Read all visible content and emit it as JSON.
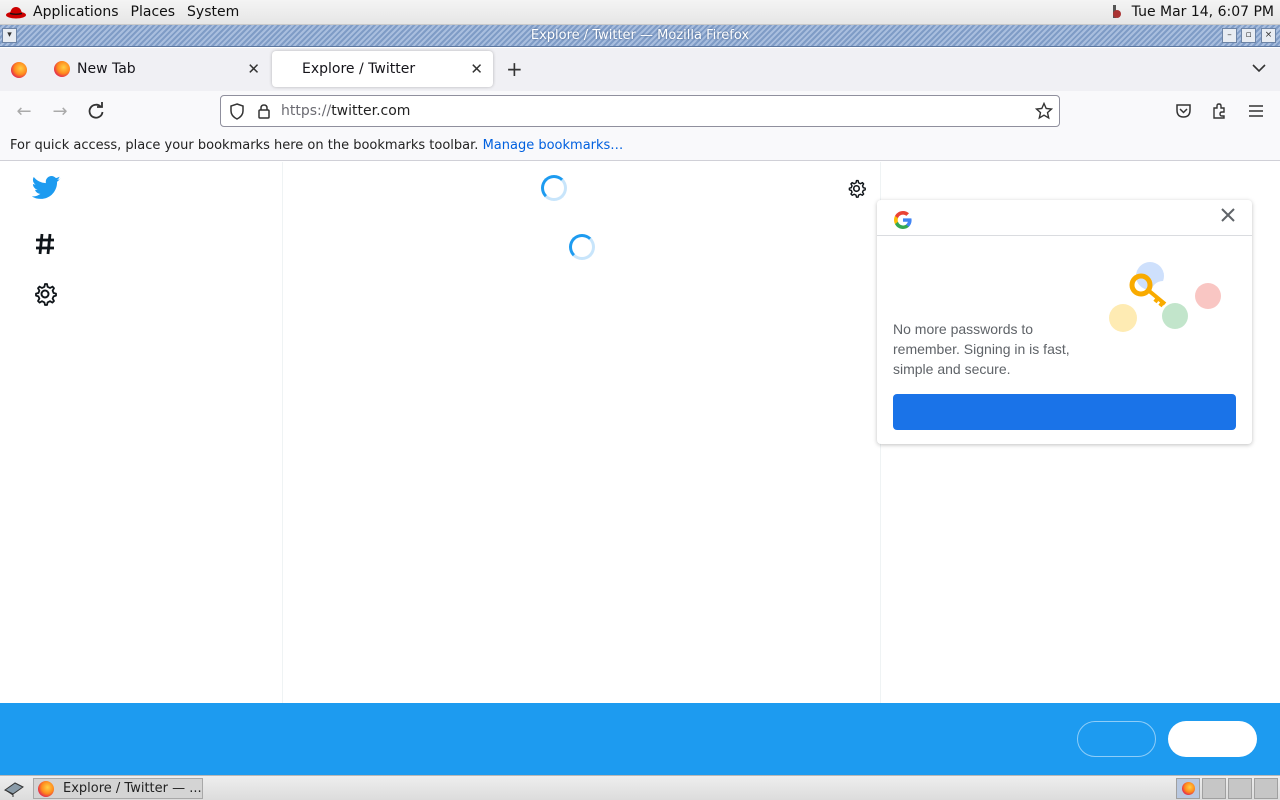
{
  "top_panel": {
    "menus": [
      "Applications",
      "Places",
      "System"
    ],
    "clock": "Tue Mar 14,  6:07 PM"
  },
  "window": {
    "title": "Explore / Twitter — Mozilla Firefox"
  },
  "tabs": [
    {
      "label": "New Tab",
      "active": false
    },
    {
      "label": "Explore / Twitter",
      "active": true
    }
  ],
  "navbar": {
    "url_scheme": "https://",
    "url_host": "twitter.com"
  },
  "bookmarks_bar": {
    "message": "For quick access, place your bookmarks here on the bookmarks toolbar.",
    "manage_link": "Manage bookmarks…"
  },
  "twitter_sidebar": {
    "icons": [
      "twitter-logo-icon",
      "hashtag-icon",
      "settings-gear-icon"
    ]
  },
  "google_popup": {
    "message": "No more passwords to remember. Signing in is fast, simple and secure.",
    "cta_label": ""
  },
  "bottom_bar": {
    "login_label": "",
    "signup_label": ""
  },
  "taskbar": {
    "task_label": "Explore / Twitter — ..."
  },
  "colors": {
    "twitter_blue": "#1d9bf0",
    "google_blue": "#1a73e8",
    "link_blue": "#0060df"
  }
}
